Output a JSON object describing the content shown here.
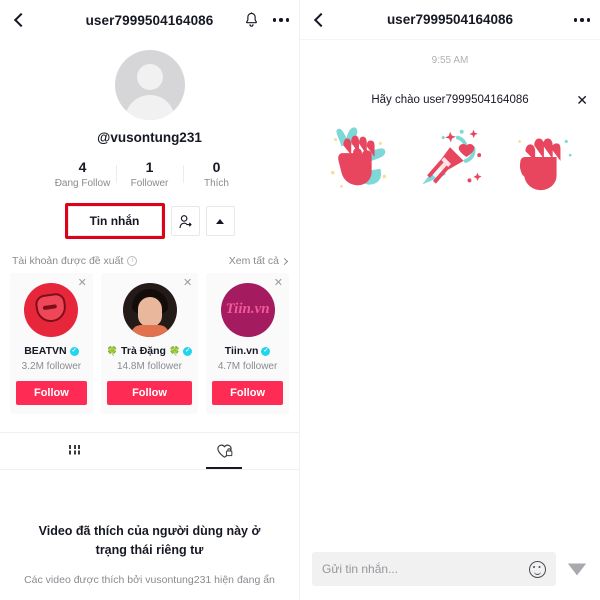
{
  "profile": {
    "topbar": {
      "back_icon": "chevron-left-icon",
      "title": "user7999504164086",
      "bell_icon": "bell-icon",
      "more_icon": "more-options-icon"
    },
    "avatar_icon": "default-user-avatar",
    "handle": "@vusontung231",
    "stats": [
      {
        "num": "4",
        "label": "Đang Follow"
      },
      {
        "num": "1",
        "label": "Follower"
      },
      {
        "num": "0",
        "label": "Thích"
      }
    ],
    "actions": {
      "message_label": "Tin nhắn",
      "highlight_color": "#e1001a",
      "add_friend_icon": "add-friend-icon",
      "expand_icon": "caret-up-icon"
    },
    "suggested": {
      "title": "Tài khoản được đề xuất",
      "info_icon": "info-icon",
      "see_all": "Xem tất cả",
      "see_all_icon": "chevron-right-icon",
      "follow_label": "Follow",
      "close_icon": "close-icon",
      "verified_icon": "verified-badge-icon",
      "cards": [
        {
          "name": "BEATVN",
          "followers": "3.2M follower",
          "verified": true,
          "prefix": "",
          "suffix": ""
        },
        {
          "name": "Trà Đặng",
          "followers": "14.8M follower",
          "verified": true,
          "prefix": "🍀",
          "suffix": "🍀"
        },
        {
          "name": "Tiin.vn",
          "followers": "4.7M follower",
          "verified": true,
          "prefix": "",
          "suffix": ""
        }
      ]
    },
    "tabs": [
      {
        "name": "videos-tab",
        "icon": "grid-icon",
        "active": false
      },
      {
        "name": "liked-tab",
        "icon": "heart-lock-icon",
        "active": true
      }
    ],
    "private": {
      "title": "Video đã thích của người dùng này ở trạng thái riêng tư",
      "subtitle": "Các video được thích bởi vusontung231 hiện đang ẩn"
    }
  },
  "chat": {
    "topbar": {
      "back_icon": "chevron-left-icon",
      "title": "user7999504164086",
      "more_icon": "more-options-icon"
    },
    "timestamp": "9:55 AM",
    "greeting": "Hãy chào user7999504164086",
    "greeting_close_icon": "close-icon",
    "stickers": [
      {
        "name": "clapping-hands-sticker"
      },
      {
        "name": "party-popper-sticker"
      },
      {
        "name": "waving-hand-sticker"
      }
    ],
    "composer": {
      "placeholder": "Gửi tin nhắn...",
      "value": "",
      "emoji_icon": "emoji-icon",
      "send_icon": "send-icon"
    }
  },
  "colors": {
    "accent": "#fe2c55",
    "verified": "#20d5ec",
    "highlight": "#e1001a",
    "text": "#161823",
    "muted": "#8a8b91"
  }
}
